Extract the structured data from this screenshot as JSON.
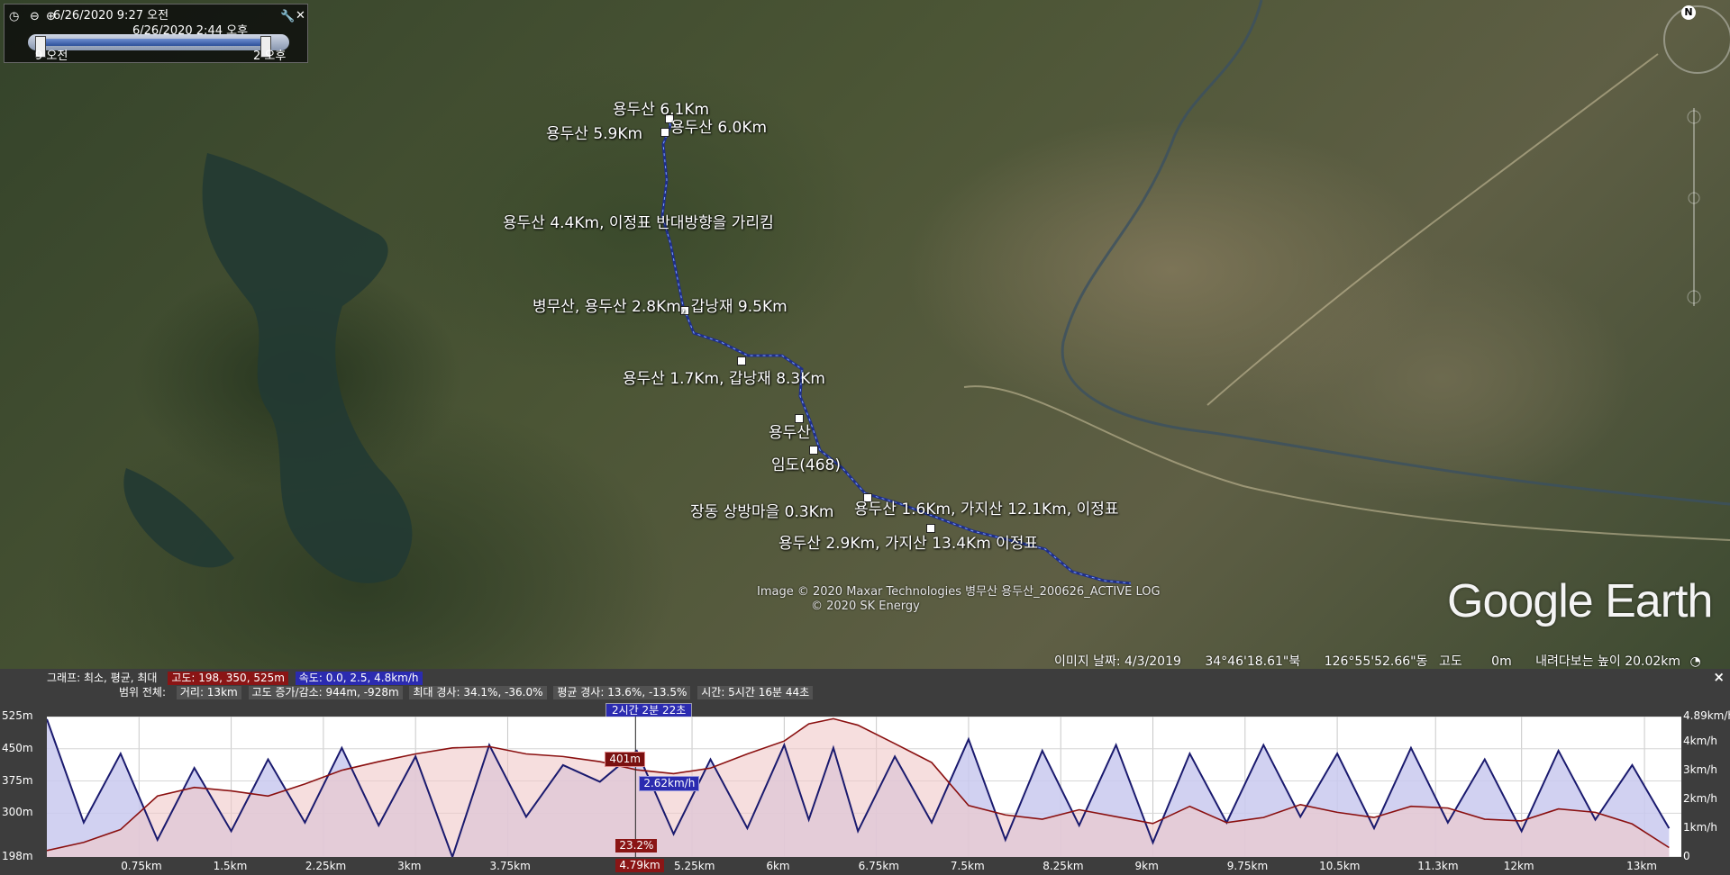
{
  "time_slider": {
    "start_datetime": "6/26/2020   9:27 오전",
    "end_datetime": "6/26/2020   2:44 오후",
    "left_label": "9 오전",
    "right_label": "2 오후"
  },
  "map": {
    "placemarks": [
      "용두산 6.1Km",
      "용두산 5.9Km",
      "용두산 6.0Km",
      "용두산 4.4Km, 이정표 반대방향을 가리킴",
      "병무산, 용두산 2.8Km, 갑낭재 9.5Km",
      "용두산 1.7Km, 갑낭재 8.3Km",
      "용두산",
      "임도(468)",
      "장동 상방마을 0.3Km",
      "용두산 1.6Km, 가지산 12.1Km, 이정표",
      "용두산 2.9Km, 가지산 13.4Km 이정표"
    ],
    "credit_line1": "Image © 2020 Maxar Technologies",
    "credit_track": "병무산 용두산_200626_ACTIVE LOG",
    "credit_line2": "© 2020 SK Energy",
    "logo": "Google Earth",
    "compass_label": "N"
  },
  "status_bar": {
    "imagery_date": "이미지 날짜: 4/3/2019",
    "lat": "34°46'18.61\"북",
    "lon": "126°55'52.66\"동",
    "elev_label": "고도",
    "elev_value": "0m",
    "eye_alt": "내려다보는 높이  20.02km"
  },
  "elevation_profile": {
    "graph_label": "그래프: 최소, 평균, 최대",
    "alt_chip": "고도: 198, 350, 525m",
    "speed_chip": "속도: 0.0, 2.5, 4.8km/h",
    "range_label": "범위 전체:",
    "distance_chip": "거리: 13km",
    "gain_chip": "고도 증가/감소: 944m, -928m",
    "max_slope_chip": "최대 경사: 34.1%, -36.0%",
    "avg_slope_chip": "평균 경사: 13.6%, -13.5%",
    "time_chip": "시간: 5시간 16분 44초",
    "duration_marker": "2시간 2분 22초",
    "close_label": "×",
    "cursor": {
      "alt_label": "401m",
      "speed_label": "2.62km/h",
      "slope_label": "23.2%",
      "dist_label": "4.79km",
      "dist_km": 4.79
    }
  },
  "chart_data": {
    "type": "line",
    "xlabel": "",
    "ylabel": "",
    "x_range": [
      0,
      13.3
    ],
    "y_left_range": [
      198,
      525
    ],
    "y_right_range": [
      0,
      4.89
    ],
    "y_left_ticks": [
      "525m",
      "450m",
      "375m",
      "300m",
      "198m"
    ],
    "y_left_tick_values": [
      525,
      450,
      375,
      300,
      198
    ],
    "y_right_ticks": [
      "4.89km/h",
      "4km/h",
      "3km/h",
      "2km/h",
      "1km/h",
      "0"
    ],
    "y_right_tick_values": [
      4.89,
      4,
      3,
      2,
      1,
      0
    ],
    "x_ticks": [
      "0.75km",
      "1.5km",
      "2.25km",
      "3km",
      "3.75km",
      "5.25km",
      "6km",
      "6.75km",
      "7.5km",
      "8.25km",
      "9km",
      "9.75km",
      "10.5km",
      "11.3km",
      "12km",
      "13km"
    ],
    "x_tick_values": [
      0.75,
      1.5,
      2.25,
      3,
      3.75,
      5.25,
      6,
      6.75,
      7.5,
      8.25,
      9,
      9.75,
      10.5,
      11.3,
      12,
      13
    ],
    "series": [
      {
        "name": "고도",
        "color": "#8a1010",
        "fill": "#f0c8c8",
        "x": [
          0,
          0.3,
          0.6,
          0.9,
          1.2,
          1.5,
          1.8,
          2.1,
          2.4,
          2.7,
          3.0,
          3.3,
          3.6,
          3.9,
          4.2,
          4.5,
          4.8,
          5.1,
          5.4,
          5.7,
          6.0,
          6.2,
          6.4,
          6.6,
          6.9,
          7.2,
          7.5,
          7.8,
          8.1,
          8.4,
          8.7,
          9.0,
          9.3,
          9.6,
          9.9,
          10.2,
          10.5,
          10.8,
          11.1,
          11.4,
          11.7,
          12.0,
          12.3,
          12.6,
          12.9,
          13.2
        ],
        "values": [
          213,
          232,
          262,
          340,
          360,
          352,
          340,
          368,
          400,
          420,
          438,
          452,
          455,
          438,
          432,
          420,
          401,
          392,
          405,
          438,
          468,
          508,
          520,
          505,
          462,
          418,
          318,
          296,
          286,
          308,
          292,
          276,
          316,
          278,
          290,
          320,
          302,
          290,
          316,
          312,
          286,
          282,
          310,
          302,
          275,
          220
        ]
      },
      {
        "name": "속도",
        "color": "#1a1a6e",
        "fill": "#c9c9ef",
        "x": [
          0,
          0.3,
          0.6,
          0.9,
          1.2,
          1.5,
          1.8,
          2.1,
          2.4,
          2.7,
          3.0,
          3.3,
          3.6,
          3.9,
          4.2,
          4.5,
          4.8,
          5.1,
          5.4,
          5.7,
          6.0,
          6.2,
          6.4,
          6.6,
          6.9,
          7.2,
          7.5,
          7.8,
          8.1,
          8.4,
          8.7,
          9.0,
          9.3,
          9.6,
          9.9,
          10.2,
          10.5,
          10.8,
          11.1,
          11.4,
          11.7,
          12.0,
          12.3,
          12.6,
          12.9,
          13.2
        ],
        "values": [
          4.8,
          1.2,
          3.6,
          0.6,
          3.1,
          0.9,
          3.4,
          1.2,
          3.8,
          1.1,
          3.5,
          0.0,
          3.9,
          1.4,
          3.2,
          2.62,
          3.7,
          0.8,
          3.4,
          1.0,
          3.9,
          1.3,
          3.8,
          0.9,
          3.5,
          1.2,
          4.1,
          0.6,
          3.7,
          1.1,
          3.9,
          0.5,
          3.6,
          1.2,
          3.9,
          1.4,
          3.6,
          1.0,
          3.8,
          1.2,
          3.4,
          0.9,
          3.7,
          1.3,
          3.2,
          1.0
        ]
      }
    ]
  }
}
